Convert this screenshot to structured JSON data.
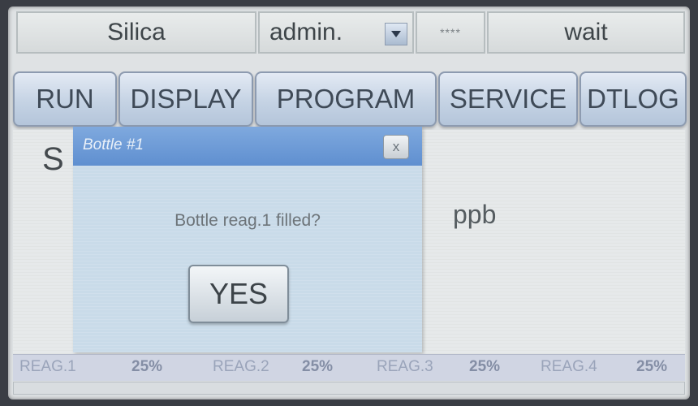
{
  "header": {
    "product": "Silica",
    "user": "admin.",
    "password_mask": "****",
    "status": "wait"
  },
  "menu": {
    "tabs": [
      {
        "label": "RUN"
      },
      {
        "label": "DISPLAY"
      },
      {
        "label": "PROGRAM"
      },
      {
        "label": "SERVICE"
      },
      {
        "label": "DTLOG"
      }
    ]
  },
  "main": {
    "parameter_letter": "S",
    "unit": "ppb"
  },
  "dialog": {
    "title": "Bottle #1",
    "close_label": "x",
    "message": "Bottle reag.1 filled?",
    "confirm_label": "YES"
  },
  "reagents": [
    {
      "label": "REAG.1",
      "level": "25%"
    },
    {
      "label": "REAG.2",
      "level": "25%"
    },
    {
      "label": "REAG.3",
      "level": "25%"
    },
    {
      "label": "REAG.4",
      "level": "25%"
    }
  ],
  "colors": {
    "dialog_titlebar": "#6f9cd8",
    "dialog_body": "#c9dbe9",
    "tab_face": "#c5d3e4",
    "screen_bg": "#dfe2e4"
  },
  "icons": {
    "user_dropdown": "chevron-down-icon",
    "dialog_close": "close-icon"
  }
}
